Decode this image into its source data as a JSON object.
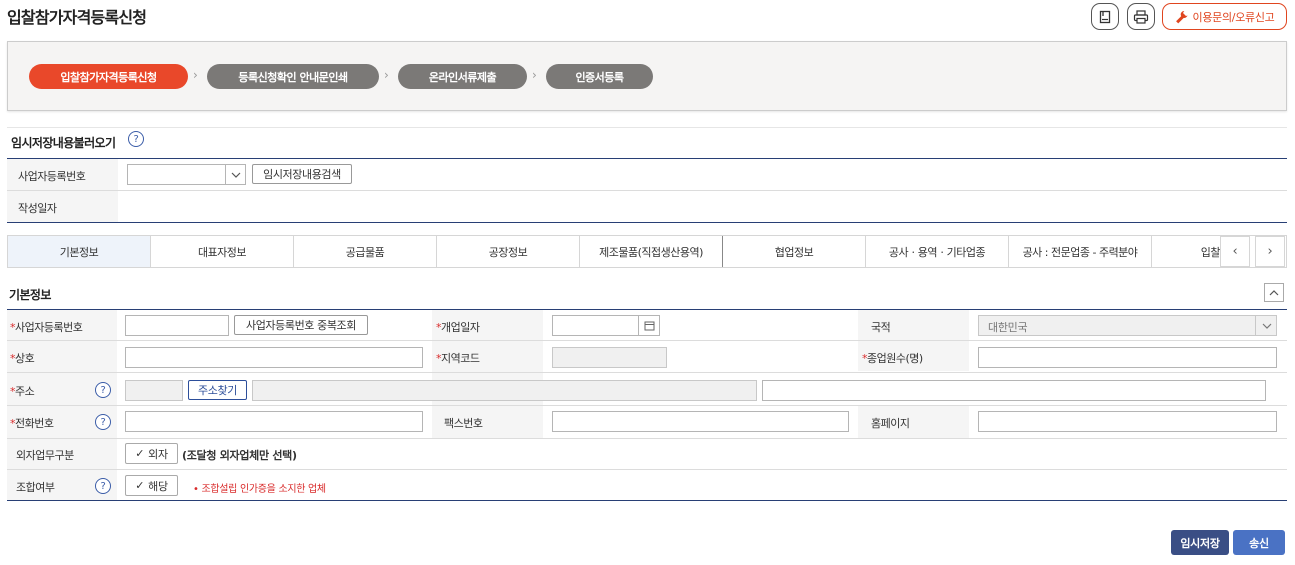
{
  "page": {
    "title": "입찰참가자격등록신청",
    "report_label": "이용문의/오류신고",
    "header_icons": [
      "bookmark-icon",
      "print-icon",
      "wrench-icon"
    ]
  },
  "steps": [
    {
      "label": "입찰참가자격등록신청",
      "active": true
    },
    {
      "label": "등록신청확인 안내문인쇄",
      "active": false
    },
    {
      "label": "온라인서류제출",
      "active": false
    },
    {
      "label": "인증서등록",
      "active": false
    }
  ],
  "temp_load": {
    "title": "임시저장내용불러오기",
    "business_no_label": "사업자등록번호",
    "search_button": "임시저장내용검색",
    "date_label": "작성일자"
  },
  "tabs": [
    "기본정보",
    "대표자정보",
    "공급물품",
    "공장정보",
    "제조물품(직접생산용역)",
    "협업정보",
    "공사ㆍ용역ㆍ기타업종",
    "공사 : 전문업종 - 주력분야",
    "입찰"
  ],
  "basic": {
    "title": "기본정보",
    "business_no_label": "사업자등록번호",
    "dup_check_button": "사업자등록번호 중복조회",
    "open_date_label": "개업일자",
    "nationality_label": "국적",
    "nationality_value": "대한민국",
    "company_name_label": "상호",
    "region_code_label": "지역코드",
    "employees_label": "종업원수(명)",
    "address_label": "주소",
    "address_search_button": "주소찾기",
    "phone_label": "전화번호",
    "fax_label": "팩스번호",
    "homepage_label": "홈페이지",
    "outsourcing_label": "외자업무구분",
    "outsourcing_check": "외자",
    "outsourcing_note": "(조달청 외자업체만 선택)",
    "union_label": "조합여부",
    "union_check": "해당",
    "union_note": "조합설립 인가증을 소지한 업체",
    "required_mark": "*"
  },
  "actions": {
    "temp_save": "임시저장",
    "send": "송신"
  },
  "colors": {
    "accent": "#e9482a",
    "navy": "#283f75",
    "idle_step": "#7b7977",
    "temp_save_btn": "#3a4e85",
    "send_btn": "#4a72c4"
  }
}
